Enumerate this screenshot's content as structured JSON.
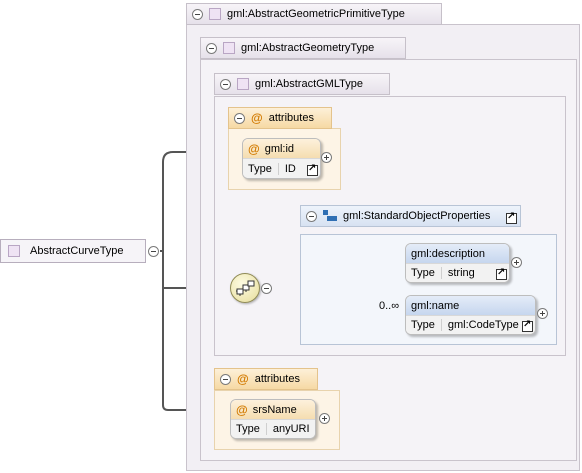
{
  "root": {
    "label": "AbstractCurveType"
  },
  "types": [
    {
      "label": "gml:AbstractGeometricPrimitiveType"
    },
    {
      "label": "gml:AbstractGeometryType"
    },
    {
      "label": "gml:AbstractGMLType"
    }
  ],
  "attribute_groups": [
    {
      "label": "attributes",
      "attribute": {
        "name": "gml:id",
        "type_label": "Type",
        "type_value": "ID"
      }
    },
    {
      "label": "attributes",
      "attribute": {
        "name": "srsName",
        "type_label": "Type",
        "type_value": "anyURI"
      }
    }
  ],
  "group": {
    "label": "gml:StandardObjectProperties",
    "elements": [
      {
        "name": "gml:description",
        "type_label": "Type",
        "type_value": "string"
      },
      {
        "name": "gml:name",
        "type_label": "Type",
        "type_value": "gml:CodeType",
        "cardinality": "0..∞"
      }
    ]
  },
  "icons": {
    "at": "@"
  }
}
